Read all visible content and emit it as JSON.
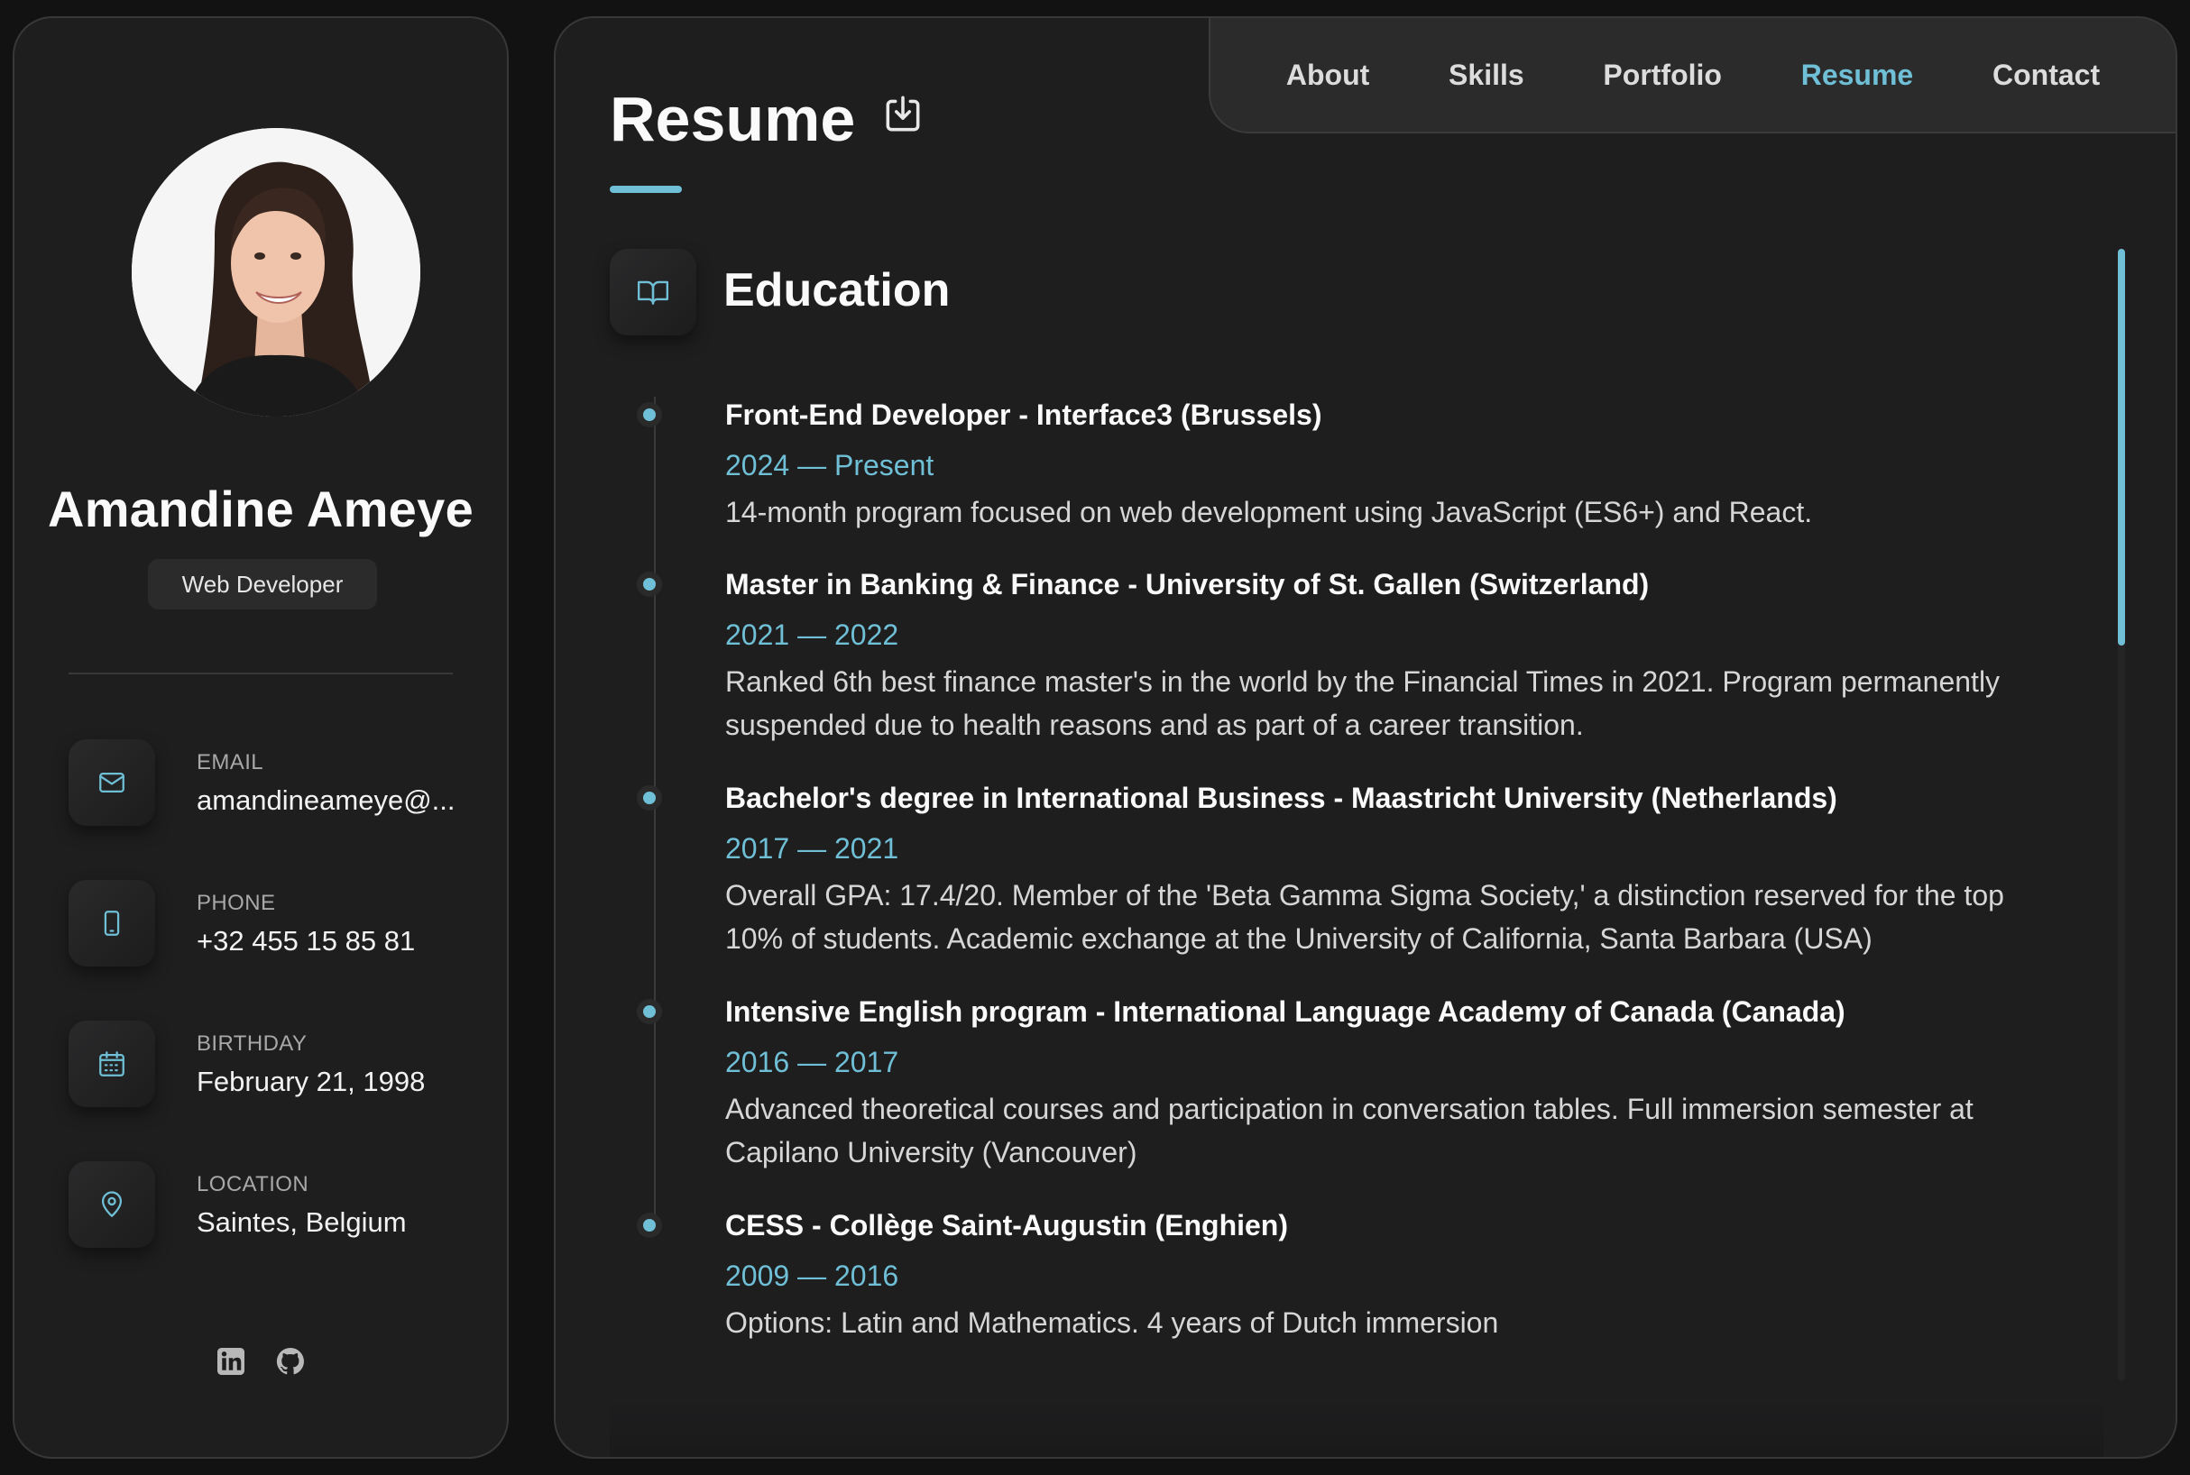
{
  "profile": {
    "name": "Amandine Ameye",
    "role": "Web Developer"
  },
  "contacts": [
    {
      "label": "Email",
      "value": "amandineameye@...",
      "icon": "mail-icon"
    },
    {
      "label": "Phone",
      "value": "+32 455 15 85 81",
      "icon": "smartphone-icon"
    },
    {
      "label": "Birthday",
      "value": "February 21, 1998",
      "icon": "calendar-icon"
    },
    {
      "label": "Location",
      "value": "Saintes, Belgium",
      "icon": "map-pin-icon"
    }
  ],
  "socials": [
    "linkedin-icon",
    "github-icon"
  ],
  "nav": {
    "items": [
      "About",
      "Skills",
      "Portfolio",
      "Resume",
      "Contact"
    ],
    "active": "Resume"
  },
  "page": {
    "title": "Resume"
  },
  "education": {
    "title": "Education",
    "items": [
      {
        "title": "Front-End Developer - Interface3 (Brussels)",
        "date": "2024 — Present",
        "description": "14-month program focused on web development using JavaScript (ES6+) and React."
      },
      {
        "title": "Master in Banking & Finance - University of St. Gallen (Switzerland)",
        "date": "2021 — 2022",
        "description": "Ranked 6th best finance master's in the world by the Financial Times in 2021. Program permanently suspended due to health reasons and as part of a career transition."
      },
      {
        "title": "Bachelor's degree in International Business - Maastricht University (Netherlands)",
        "date": "2017 — 2021",
        "description": "Overall GPA: 17.4/20. Member of the 'Beta Gamma Sigma Society,' a distinction reserved for the top 10% of students. Academic exchange at the University of California, Santa Barbara (USA)"
      },
      {
        "title": "Intensive English program - International Language Academy of Canada (Canada)",
        "date": "2016 — 2017",
        "description": "Advanced theoretical courses and participation in conversation tables. Full immersion semester at Capilano University (Vancouver)"
      },
      {
        "title": "CESS - Collège Saint-Augustin (Enghien)",
        "date": "2009 — 2016",
        "description": "Options: Latin and Mathematics. 4 years of Dutch immersion"
      }
    ]
  },
  "colors": {
    "accent": "#6fbfd6",
    "background": "#121212",
    "panel": "#1e1e1f"
  }
}
